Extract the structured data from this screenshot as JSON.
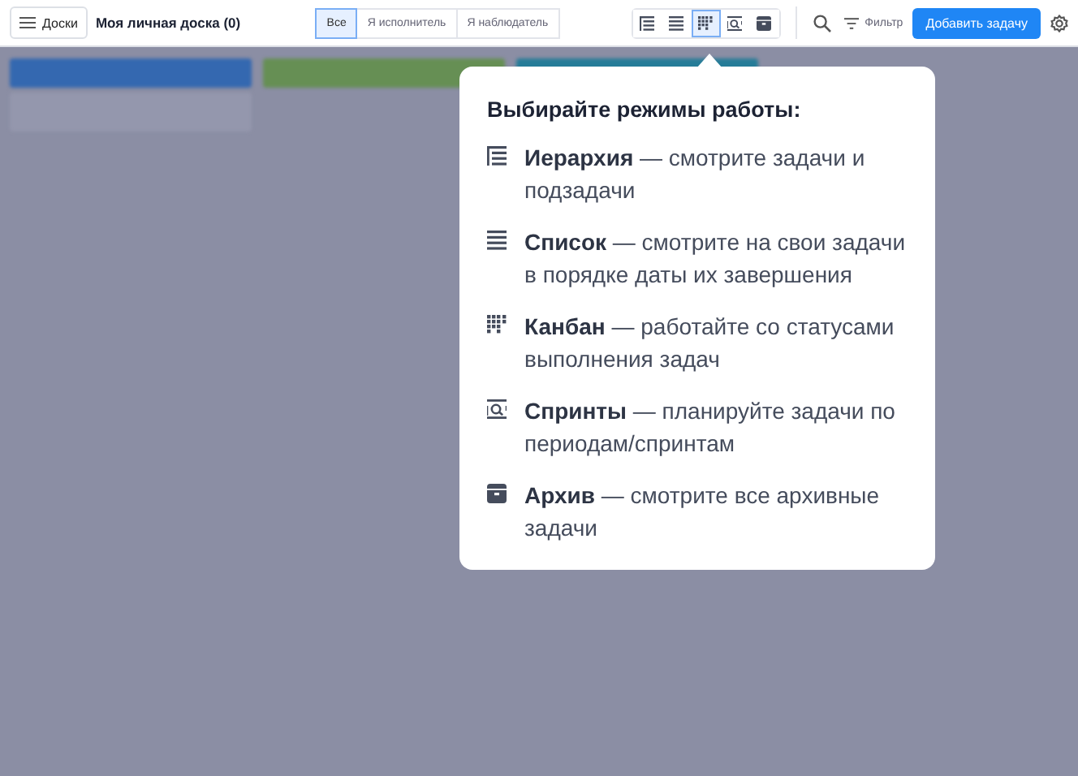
{
  "header": {
    "boards_button": "Доски",
    "board_title": "Моя личная доска (0)",
    "filters": [
      {
        "label": "Все",
        "selected": true
      },
      {
        "label": "Я исполнитель",
        "selected": false
      },
      {
        "label": "Я наблюдатель",
        "selected": false
      }
    ],
    "views": [
      {
        "kind": "hierarchy",
        "selected": false
      },
      {
        "kind": "list",
        "selected": false
      },
      {
        "kind": "kanban",
        "selected": true
      },
      {
        "kind": "sprints",
        "selected": false
      },
      {
        "kind": "archive",
        "selected": false
      }
    ],
    "filter_label": "Фильтр",
    "add_button": "Добавить задачу"
  },
  "popover": {
    "title": "Выбирайте режимы работы:",
    "items": [
      {
        "kind": "hierarchy",
        "text": "**Иерархия** — смотрите задачи и подзадачи"
      },
      {
        "kind": "list",
        "text": "**Список** — смотрите на свои задачи в порядке даты их завершения"
      },
      {
        "kind": "kanban",
        "text": "**Канбан** — работайте со статусами выполнения задач"
      },
      {
        "kind": "sprints",
        "text": "**Спринты** — планируйте задачи по периодам/спринтам"
      },
      {
        "kind": "archive",
        "text": "**Архив** — смотрите все архивные задачи"
      }
    ]
  }
}
